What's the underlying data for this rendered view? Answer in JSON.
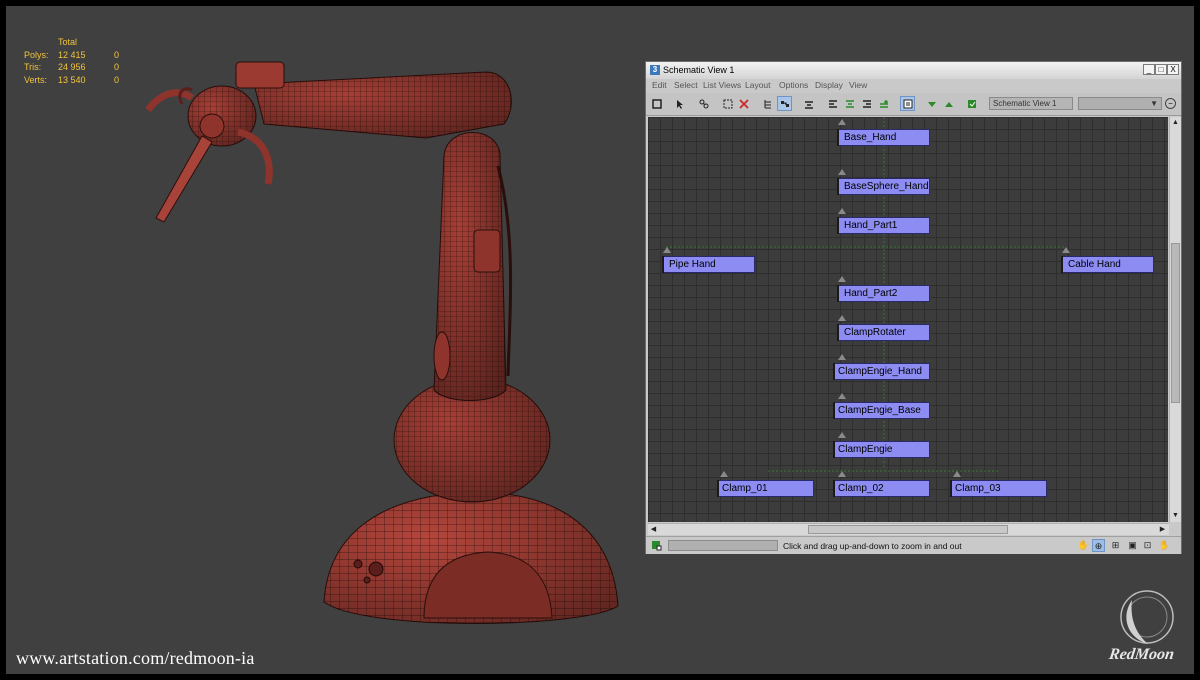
{
  "stats": {
    "header": "Total",
    "rows": [
      {
        "label": "Polys:",
        "total": "12 415",
        "selected": "0"
      },
      {
        "label": "Tris:",
        "total": "24 956",
        "selected": "0"
      },
      {
        "label": "Verts:",
        "total": "13 540",
        "selected": "0"
      }
    ]
  },
  "schematic": {
    "title": "Schematic View 1",
    "app_icon": "3",
    "window_buttons": {
      "minimize": "_",
      "maximize": "□",
      "close": "X"
    },
    "menu": [
      "Edit",
      "Select",
      "List Views",
      "Layout",
      "Options",
      "Display",
      "View"
    ],
    "toolbar": {
      "view_name": "Schematic View 1",
      "dropdown_value": "",
      "dropdown_arrow": "▼"
    },
    "nodes": {
      "base_hand": "Base_Hand",
      "basesphere_hand": "BaseSphere_Hand",
      "hand_part1": "Hand_Part1",
      "pipe_hand": "Pipe Hand",
      "cable_hand": "Cable Hand",
      "hand_part2": "Hand_Part2",
      "clamprotater": "ClampRotater",
      "clampengie_hand": "ClampEngie_Hand",
      "clampengie_base": "ClampEngie_Base",
      "clampengie": "ClampEngie",
      "clamp_01": "Clamp_01",
      "clamp_02": "Clamp_02",
      "clamp_03": "Clamp_03"
    },
    "status_message": "Click and drag up-and-down to zoom in and out"
  },
  "watermark": "www.artstation.com/redmoon-ia",
  "logo_text": "RedMoon",
  "colors": {
    "viewport_bg": "#404040",
    "stats_text": "#f2c33b",
    "node_fill": "#8c8cf2",
    "mesh_red": "#b5463c",
    "link_green": "#2f7a2f"
  }
}
